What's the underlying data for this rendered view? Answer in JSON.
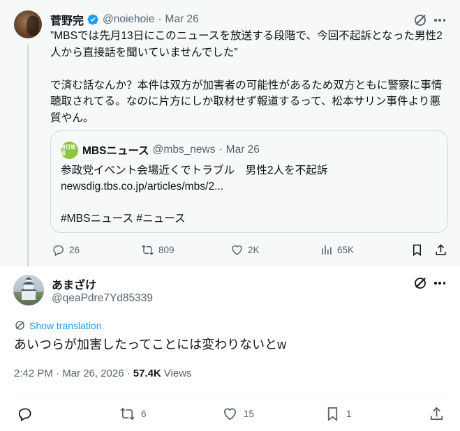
{
  "parent_tweet": {
    "author_name": "菅野完",
    "handle": "@noiehoie",
    "separator": "·",
    "date": "Mar 26",
    "text": "”MBSでは先月13日にこのニュースを放送する段階で、今回不起訴となった男性2人から直接話を聞いていませんでした”\n\nで済む話なんか？本件は双方が加害者の可能性があるため双方ともに警察に事情聴取されてる。なのに片方にしか取材せず報道するって、松本サリン事件より悪質やん。",
    "quote": {
      "avatar_text": "毎日放送",
      "author_name": "MBSニュース",
      "handle": "@mbs_news",
      "separator": "·",
      "date": "Mar 26",
      "text": "参政党イベント会場近くでトラブル　男性2人を不起訴\nnewsdig.tbs.co.jp/articles/mbs/2...\n\n#MBSニュース #ニュース"
    },
    "actions": {
      "replies": "26",
      "reposts": "809",
      "likes": "2K",
      "views": "65K"
    }
  },
  "reply_tweet": {
    "author_name": "あまざけ",
    "handle": "@qeaPdre7Yd85339",
    "translate_label": "Show translation",
    "text": "あいつらが加害したってことには変わりないとw",
    "timestamp": "2:42 PM · Mar 26, 2026 ·",
    "views_count": "57.4K",
    "views_label": "Views",
    "actions": {
      "reposts": "6",
      "likes": "15",
      "bookmarks": "1"
    }
  },
  "colors": {
    "text": "#0f1419",
    "secondary": "#536471",
    "link": "#1d9bf0",
    "verified": "#1d9bf0",
    "parent_bg": "#f7f9f9"
  }
}
